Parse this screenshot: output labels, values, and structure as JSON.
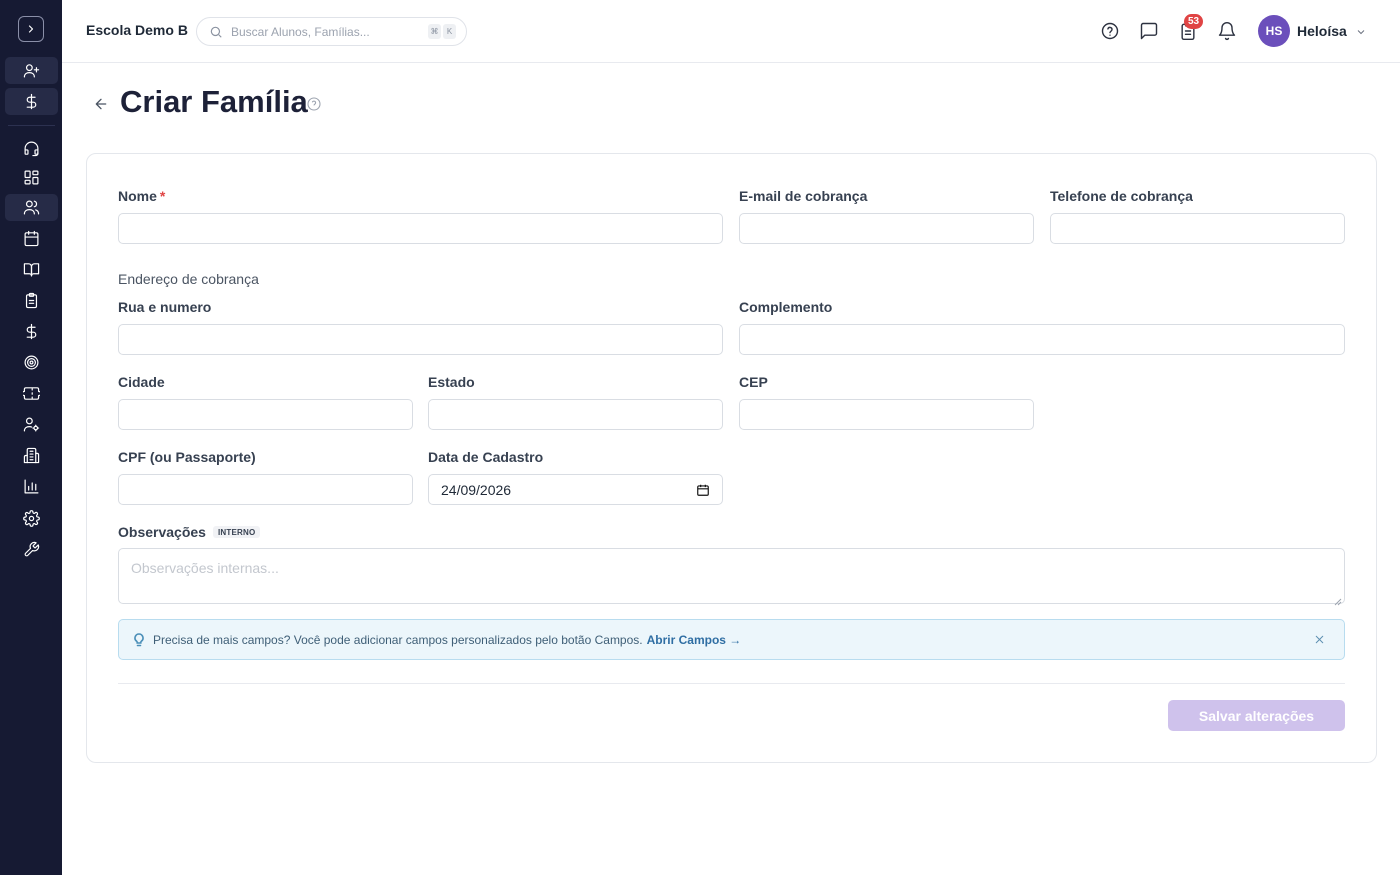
{
  "header": {
    "school_name": "Escola Demo B",
    "search_placeholder": "Buscar Alunos, Famílias...",
    "shortcut_key1": "⌘",
    "shortcut_key2": "K",
    "notification_count": "53",
    "user_initials": "HS",
    "user_name": "Heloísa"
  },
  "sidebar": {
    "items": [
      {
        "icon": "user-plus-icon"
      },
      {
        "icon": "dollar-icon"
      },
      {
        "icon": "headset-icon"
      },
      {
        "icon": "dashboard-grid-icon"
      },
      {
        "icon": "users-icon",
        "active": true
      },
      {
        "icon": "calendar-icon"
      },
      {
        "icon": "book-icon"
      },
      {
        "icon": "clipboard-icon"
      },
      {
        "icon": "dollar-icon"
      },
      {
        "icon": "target-icon"
      },
      {
        "icon": "ticket-icon"
      },
      {
        "icon": "user-settings-icon"
      },
      {
        "icon": "building-icon"
      },
      {
        "icon": "bar-chart-icon"
      },
      {
        "icon": "gear-icon"
      },
      {
        "icon": "wrench-icon"
      }
    ]
  },
  "page": {
    "title": "Criar Família"
  },
  "form": {
    "nome_label": "Nome",
    "required_mark": "*",
    "email_label": "E-mail de cobrança",
    "telefone_label": "Telefone de cobrança",
    "endereco_section": "Endereço de cobrança",
    "rua_label": "Rua e numero",
    "complemento_label": "Complemento",
    "cidade_label": "Cidade",
    "estado_label": "Estado",
    "cep_label": "CEP",
    "cpf_label": "CPF (ou Passaporte)",
    "data_cadastro_label": "Data de Cadastro",
    "data_cadastro_value": "24/09/2026",
    "observacoes_label": "Observações",
    "interno_tag": "INTERNO",
    "observacoes_placeholder": "Observações internas..."
  },
  "info_banner": {
    "text": "Precisa de mais campos? Você pode adicionar campos personalizados pelo botão Campos.",
    "link": "Abrir Campos →"
  },
  "actions": {
    "save_label": "Salvar alterações"
  },
  "colors": {
    "sidebar_bg": "#161a33",
    "accent": "#6b4fbb",
    "save_disabled": "#cfc2ec",
    "badge": "#e04444"
  }
}
